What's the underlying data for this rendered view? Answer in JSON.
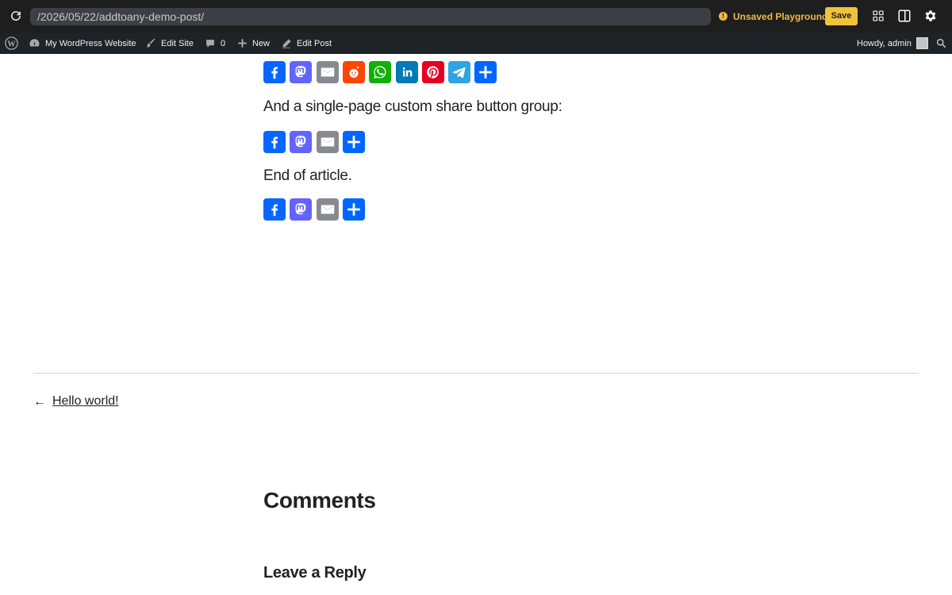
{
  "browser": {
    "url": "/2026/05/22/addtoany-demo-post/",
    "status": "Unsaved Playground",
    "save_label": "Save"
  },
  "admin_bar": {
    "site_name": "My WordPress Website",
    "edit_site": "Edit Site",
    "comments_count": "0",
    "new_label": "New",
    "edit_post": "Edit Post",
    "howdy": "Howdy, admin"
  },
  "content": {
    "custom_group_intro": "And a single-page custom share button group:",
    "end_text": "End of article.",
    "share_row_1": [
      "facebook",
      "mastodon",
      "email",
      "reddit",
      "whatsapp",
      "linkedin",
      "pinterest",
      "telegram",
      "share"
    ],
    "share_row_2": [
      "facebook",
      "mastodon",
      "email",
      "share"
    ],
    "share_row_3": [
      "facebook",
      "mastodon",
      "email",
      "share"
    ],
    "colors": {
      "facebook": "#0866ff",
      "mastodon": "#6364ff",
      "email": "#888990",
      "reddit": "#ff4500",
      "whatsapp": "#12af0a",
      "linkedin": "#007bb5",
      "pinterest": "#e60023",
      "telegram": "#2ca5e0",
      "share": "#0166ff"
    }
  },
  "navigation": {
    "prev_arrow": "←",
    "prev_title": "Hello world!"
  },
  "comments": {
    "heading": "Comments",
    "reply_heading": "Leave a Reply"
  }
}
